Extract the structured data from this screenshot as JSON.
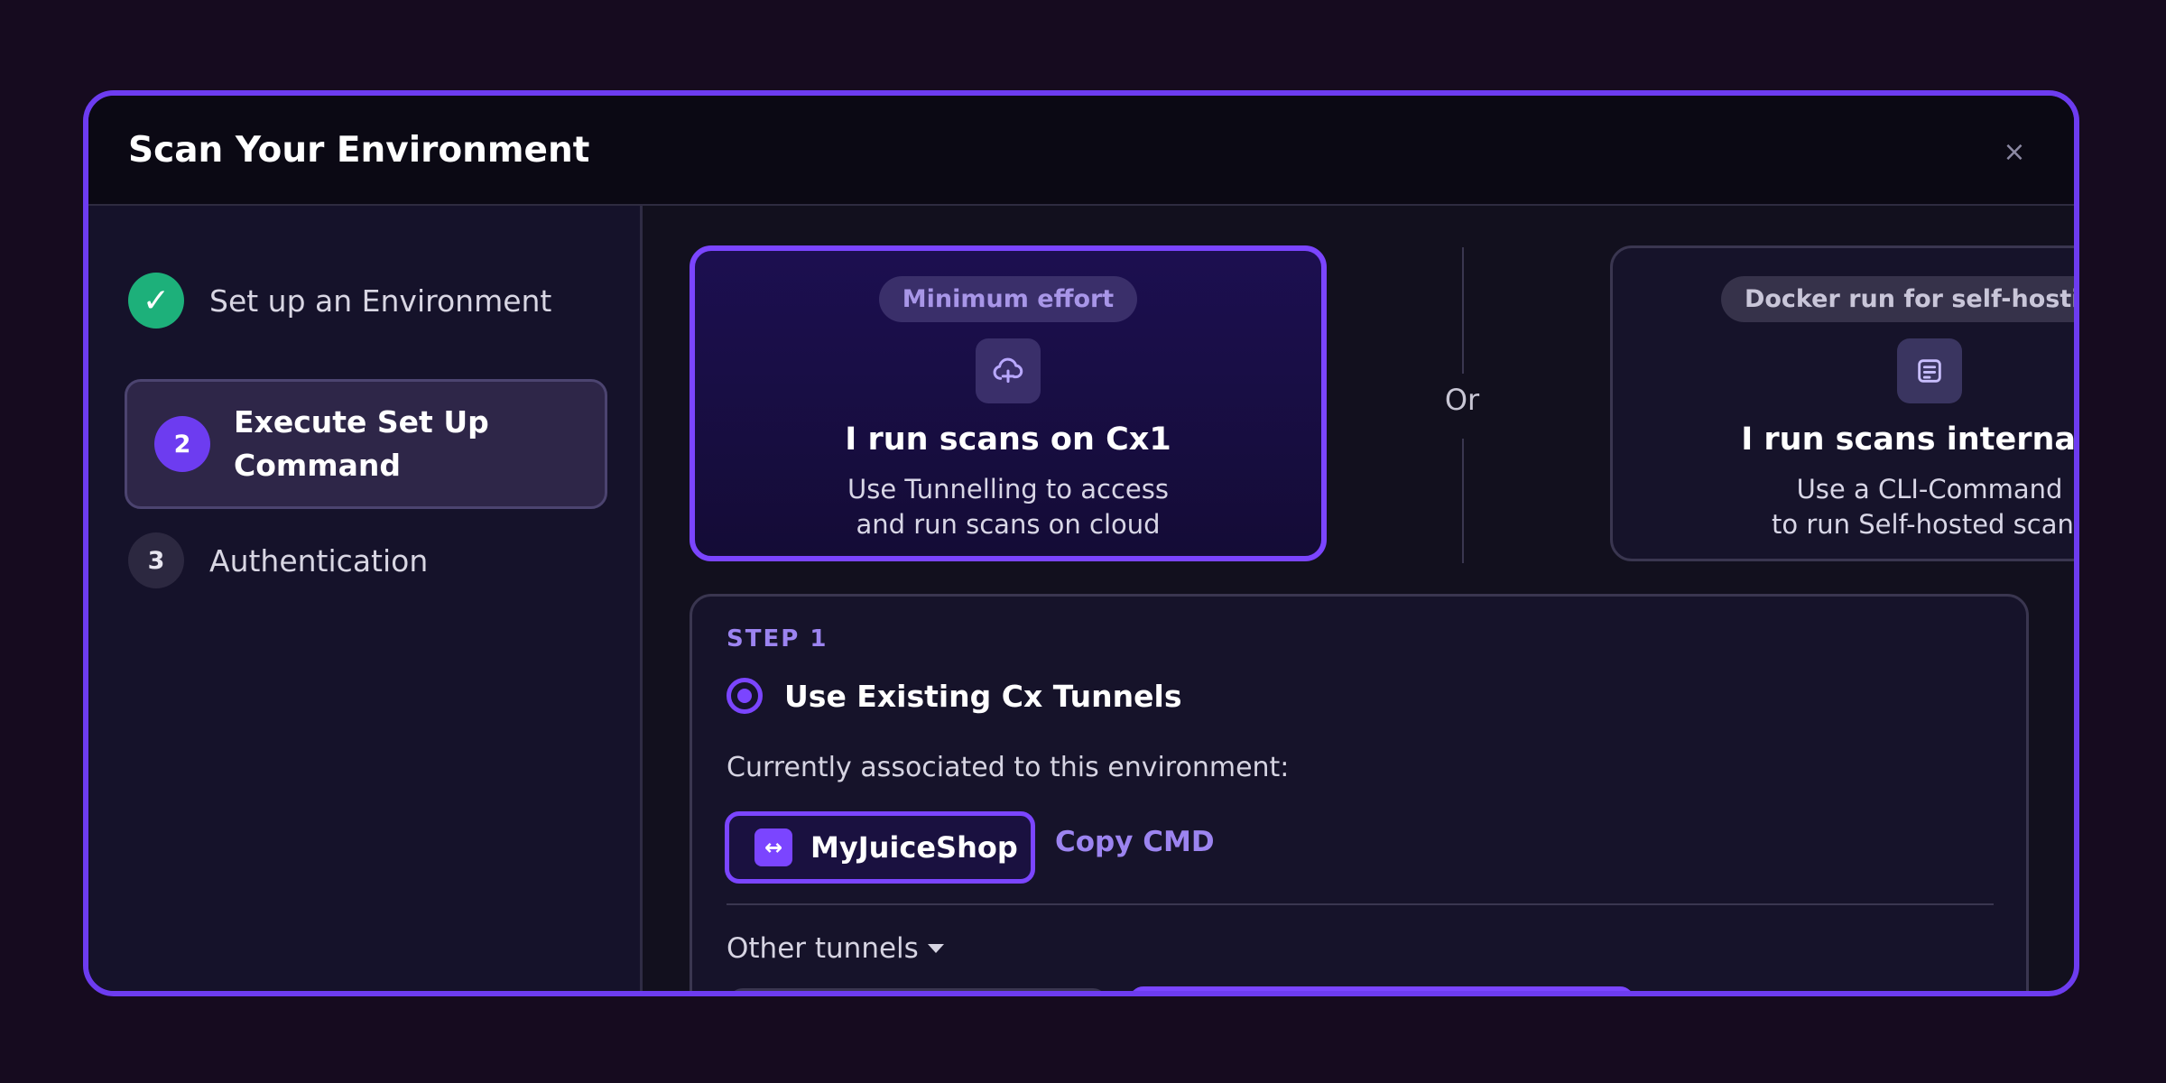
{
  "modal": {
    "title": "Scan Your Environment",
    "close_glyph": "×"
  },
  "sidebar": {
    "steps": [
      {
        "marker": "✓",
        "label": "Set up an Environment",
        "state": "complete"
      },
      {
        "marker": "2",
        "label": "Execute Set Up Command",
        "state": "active"
      },
      {
        "marker": "3",
        "label": "Authentication",
        "state": "pending"
      }
    ]
  },
  "options": {
    "cx1": {
      "badge": "Minimum effort",
      "icon": "cloud-plus-icon",
      "title": "I run scans on Cx1",
      "desc_line1": "Use Tunnelling to access",
      "desc_line2": "and run scans on cloud",
      "selected": true
    },
    "or_label": "Or",
    "internal": {
      "badge": "Docker run for self-hosting",
      "icon": "document-icon",
      "title": "I run scans internally",
      "desc_line1": "Use a CLI-Command",
      "desc_line2": "to run Self-hosted scans",
      "selected": false
    }
  },
  "step_panel": {
    "kicker": "STEP 1",
    "radio_label": "Use Existing Cx Tunnels",
    "assoc_text": "Currently associated to this environment:",
    "tunnel": {
      "icon": "↔",
      "name": "MyJuiceShop"
    },
    "copy_cmd": "Copy CMD",
    "other_tunnels": "Other tunnels"
  },
  "colors": {
    "accent": "#7b45ff",
    "success": "#1db07a",
    "background": "#160b1f"
  }
}
